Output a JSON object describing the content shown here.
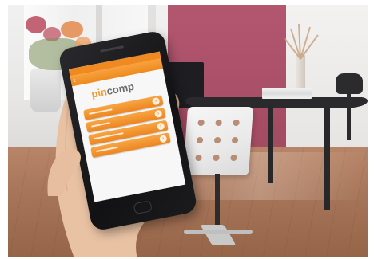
{
  "photo": {
    "subject": "hand-holding-smartphone",
    "setting": "office-room"
  },
  "app": {
    "brand_pin": "pin",
    "brand_dot": "",
    "brand_comp": "comp",
    "accent": "#f08a20",
    "menu_items": [
      "",
      "",
      "",
      ""
    ]
  },
  "colors": {
    "accent_orange": "#f08a20",
    "wall_pink": "#a94f67",
    "floor_wood": "#a67458",
    "phone_black": "#141416"
  },
  "icons": {
    "back": "back-arrow-icon",
    "chevron": "chevron-right-icon"
  }
}
